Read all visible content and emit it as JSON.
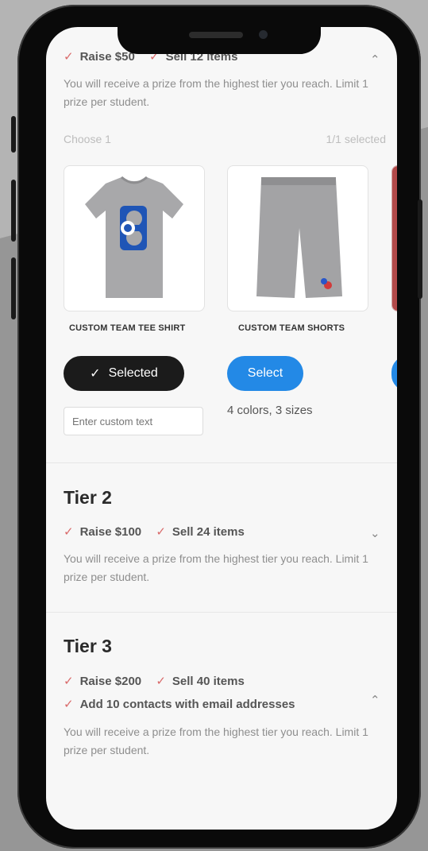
{
  "tier1": {
    "requirements": [
      "Raise $50",
      "Sell 12 items"
    ],
    "description": "You will receive a prize from the highest tier you reach. Limit 1 prize per student.",
    "choose_label": "Choose 1",
    "selected_count": "1/1 selected",
    "products": [
      {
        "name": "CUSTOM TEAM TEE SHIRT",
        "button_label": "Selected",
        "state": "selected"
      },
      {
        "name": "CUSTOM TEAM SHORTS",
        "button_label": "Select",
        "state": "unselected",
        "variants": "4 colors, 3 sizes"
      }
    ],
    "custom_text_placeholder": "Enter custom text"
  },
  "tier2": {
    "title": "Tier 2",
    "requirements": [
      "Raise $100",
      "Sell 24 items"
    ],
    "description": "You will receive a prize from the highest tier you reach. Limit 1 prize per student."
  },
  "tier3": {
    "title": "Tier 3",
    "requirements": [
      "Raise $200",
      "Sell 40 items",
      "Add 10 contacts with email addresses"
    ],
    "description": "You will receive a prize from the highest tier you reach. Limit 1 prize per student."
  },
  "icons": {
    "check": "✓",
    "chevron_up": "⌃",
    "chevron_down": "⌄"
  },
  "colors": {
    "check_mark": "#d96a6a",
    "select_button": "#2389e6",
    "selected_button": "#1b1b1b"
  }
}
